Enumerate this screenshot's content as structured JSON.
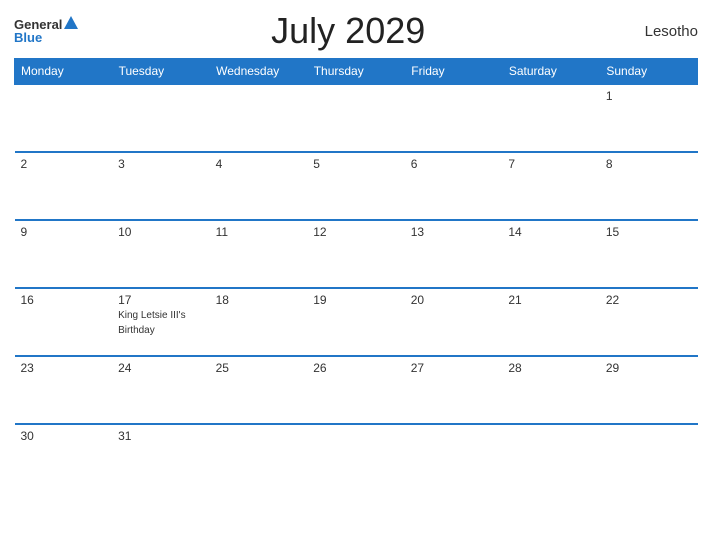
{
  "header": {
    "logo_general": "General",
    "logo_blue": "Blue",
    "title": "July 2029",
    "country": "Lesotho"
  },
  "weekdays": [
    "Monday",
    "Tuesday",
    "Wednesday",
    "Thursday",
    "Friday",
    "Saturday",
    "Sunday"
  ],
  "weeks": [
    [
      {
        "day": "",
        "event": ""
      },
      {
        "day": "",
        "event": ""
      },
      {
        "day": "",
        "event": ""
      },
      {
        "day": "",
        "event": ""
      },
      {
        "day": "",
        "event": ""
      },
      {
        "day": "",
        "event": ""
      },
      {
        "day": "1",
        "event": ""
      }
    ],
    [
      {
        "day": "2",
        "event": ""
      },
      {
        "day": "3",
        "event": ""
      },
      {
        "day": "4",
        "event": ""
      },
      {
        "day": "5",
        "event": ""
      },
      {
        "day": "6",
        "event": ""
      },
      {
        "day": "7",
        "event": ""
      },
      {
        "day": "8",
        "event": ""
      }
    ],
    [
      {
        "day": "9",
        "event": ""
      },
      {
        "day": "10",
        "event": ""
      },
      {
        "day": "11",
        "event": ""
      },
      {
        "day": "12",
        "event": ""
      },
      {
        "day": "13",
        "event": ""
      },
      {
        "day": "14",
        "event": ""
      },
      {
        "day": "15",
        "event": ""
      }
    ],
    [
      {
        "day": "16",
        "event": ""
      },
      {
        "day": "17",
        "event": "King Letsie III's Birthday"
      },
      {
        "day": "18",
        "event": ""
      },
      {
        "day": "19",
        "event": ""
      },
      {
        "day": "20",
        "event": ""
      },
      {
        "day": "21",
        "event": ""
      },
      {
        "day": "22",
        "event": ""
      }
    ],
    [
      {
        "day": "23",
        "event": ""
      },
      {
        "day": "24",
        "event": ""
      },
      {
        "day": "25",
        "event": ""
      },
      {
        "day": "26",
        "event": ""
      },
      {
        "day": "27",
        "event": ""
      },
      {
        "day": "28",
        "event": ""
      },
      {
        "day": "29",
        "event": ""
      }
    ],
    [
      {
        "day": "30",
        "event": ""
      },
      {
        "day": "31",
        "event": ""
      },
      {
        "day": "",
        "event": ""
      },
      {
        "day": "",
        "event": ""
      },
      {
        "day": "",
        "event": ""
      },
      {
        "day": "",
        "event": ""
      },
      {
        "day": "",
        "event": ""
      }
    ]
  ]
}
